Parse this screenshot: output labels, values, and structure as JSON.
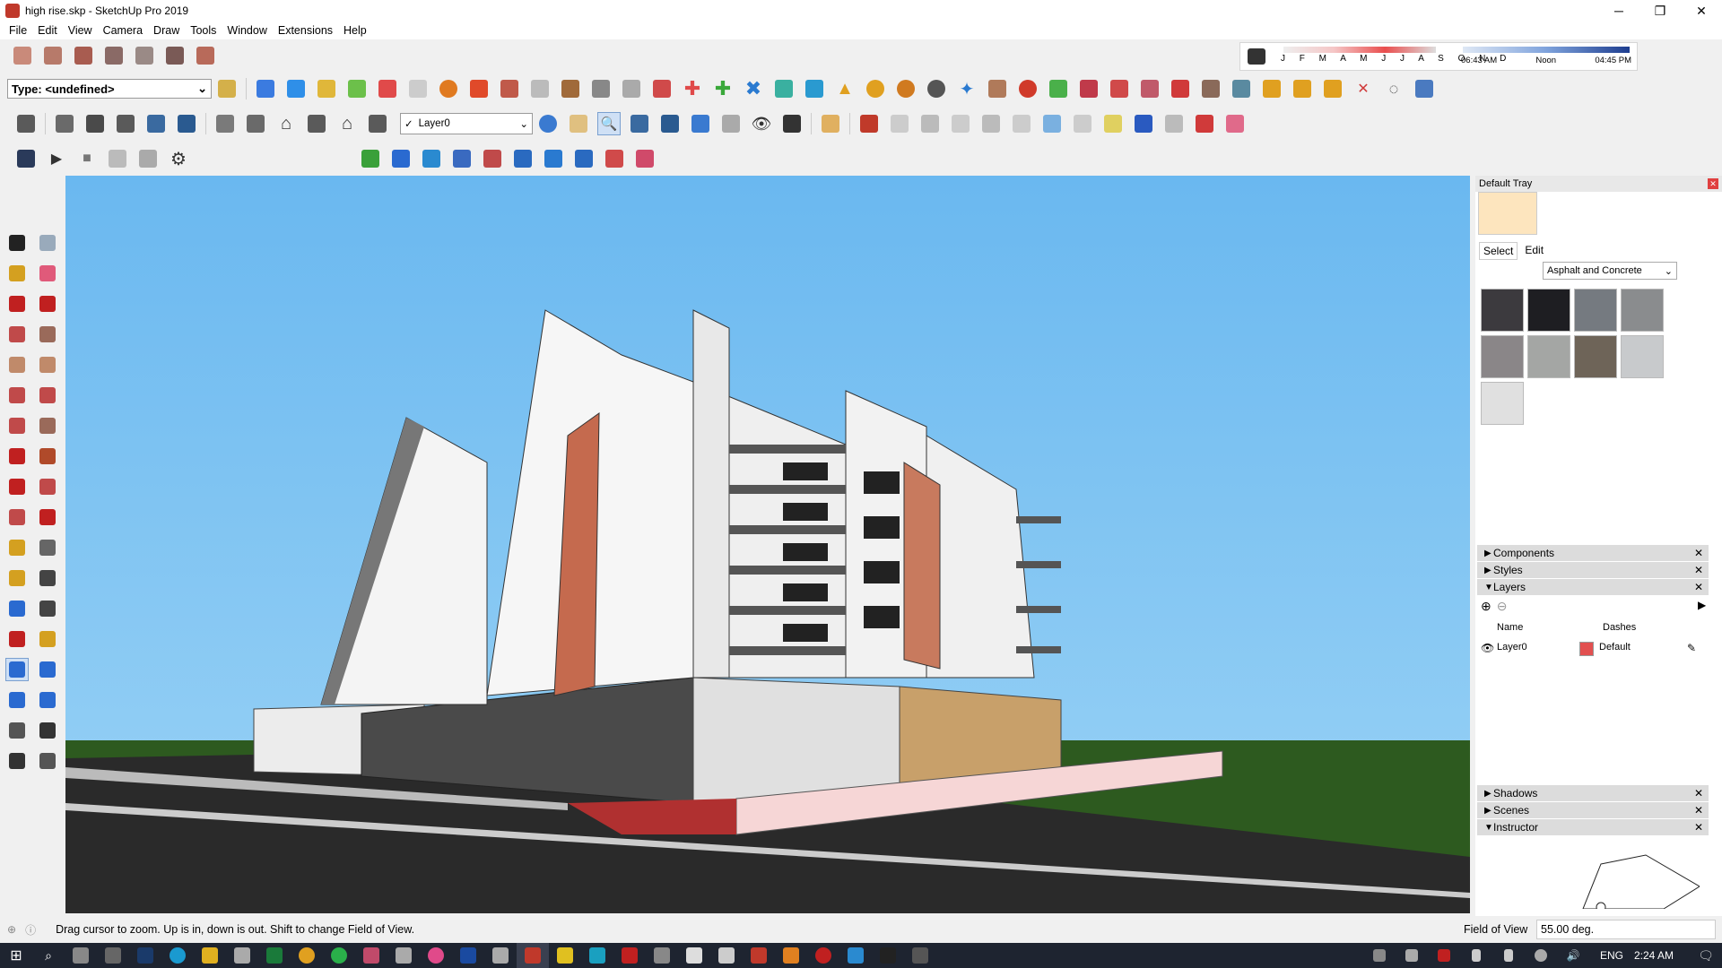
{
  "window": {
    "title": "high rise.skp - SketchUp Pro 2019",
    "minimize": "─",
    "restore": "❐",
    "close": "✕"
  },
  "menu": [
    "File",
    "Edit",
    "View",
    "Camera",
    "Draw",
    "Tools",
    "Window",
    "Extensions",
    "Help"
  ],
  "toolbar": {
    "type_select": "Type: <undefined>",
    "layer_select": "Layer0",
    "layer_check": "✓"
  },
  "shadows": {
    "months": "J F M A M J J A S O N D",
    "time_start": "06:43 AM",
    "time_mid": "Noon",
    "time_end": "04:45 PM"
  },
  "tray": {
    "title": "Default Tray",
    "tab_select": "Select",
    "tab_edit": "Edit",
    "library": "Asphalt and Concrete",
    "sections": {
      "components": "Components",
      "styles": "Styles",
      "layers": "Layers",
      "shadows": "Shadows",
      "scenes": "Scenes",
      "instructor": "Instructor"
    },
    "layers_table": {
      "col_name": "Name",
      "col_dashes": "Dashes",
      "row_name": "Layer0",
      "row_dashes": "Default",
      "row_color": "#e25050"
    }
  },
  "status": {
    "message": "Drag cursor to zoom.  Up is in, down is out. Shift to change Field of View.",
    "measure_label": "Field of View",
    "measure_value": "55.00 deg."
  },
  "taskbar": {
    "lang": "ENG",
    "time": "2:24 AM"
  },
  "icons": {
    "left": [
      "select-icon",
      "component-icon",
      "paint-bucket-icon",
      "eraser-icon",
      "line-icon",
      "freehand-icon",
      "rectangle-icon",
      "rotated-rectangle-icon",
      "circle-icon",
      "polygon-icon",
      "arc-icon",
      "pie-icon",
      "two-point-arc-icon",
      "three-point-arc-icon",
      "move-icon",
      "push-pull-icon",
      "rotate-icon",
      "follow-me-icon",
      "scale-icon",
      "offset-icon",
      "tape-measure-icon",
      "text-icon",
      "protractor-icon",
      "axes-icon",
      "dimension-icon",
      "3d-text-icon",
      "orbit-icon",
      "pan-icon",
      "zoom-icon",
      "zoom-window-icon",
      "zoom-extents-icon",
      "previous-view-icon",
      "position-camera-icon",
      "look-around-icon",
      "walk-icon",
      "section-plane-icon"
    ]
  }
}
